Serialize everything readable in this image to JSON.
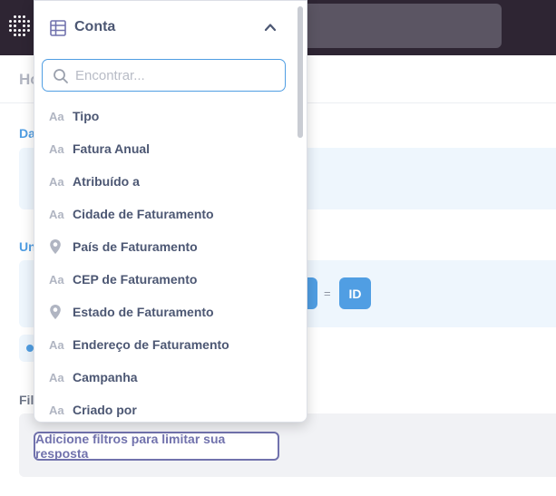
{
  "page": {
    "title_fragment": "Ho",
    "sections": {
      "data_label": "Da",
      "join_label": "Un",
      "filter_label": "Fil"
    },
    "join": {
      "equals": "=",
      "right_column": "ID"
    },
    "add_filter_label": "Adicione filtros para limitar sua resposta"
  },
  "dropdown": {
    "title": "Conta",
    "search_placeholder": "Encontrar...",
    "fields": [
      {
        "label": "Tipo",
        "icon": "text-type-icon",
        "glyph": "Aa"
      },
      {
        "label": "Fatura Anual",
        "icon": "text-type-icon",
        "glyph": "Aa"
      },
      {
        "label": "Atribuído a",
        "icon": "text-type-icon",
        "glyph": "Aa"
      },
      {
        "label": "Cidade de Faturamento",
        "icon": "text-type-icon",
        "glyph": "Aa"
      },
      {
        "label": "País de Faturamento",
        "icon": "location-pin-icon",
        "glyph": ""
      },
      {
        "label": "CEP de Faturamento",
        "icon": "text-type-icon",
        "glyph": "Aa"
      },
      {
        "label": "Estado de Faturamento",
        "icon": "location-pin-icon",
        "glyph": ""
      },
      {
        "label": "Endereço de Faturamento",
        "icon": "text-type-icon",
        "glyph": "Aa"
      },
      {
        "label": "Campanha",
        "icon": "text-type-icon",
        "glyph": "Aa"
      },
      {
        "label": "Criado por",
        "icon": "text-type-icon",
        "glyph": "Aa"
      }
    ]
  },
  "colors": {
    "topbar": "#2e2533",
    "accent": "#509ee3",
    "filter_accent": "#7172ad",
    "text": "#4c5773",
    "icon_muted": "#b0b5c2"
  }
}
